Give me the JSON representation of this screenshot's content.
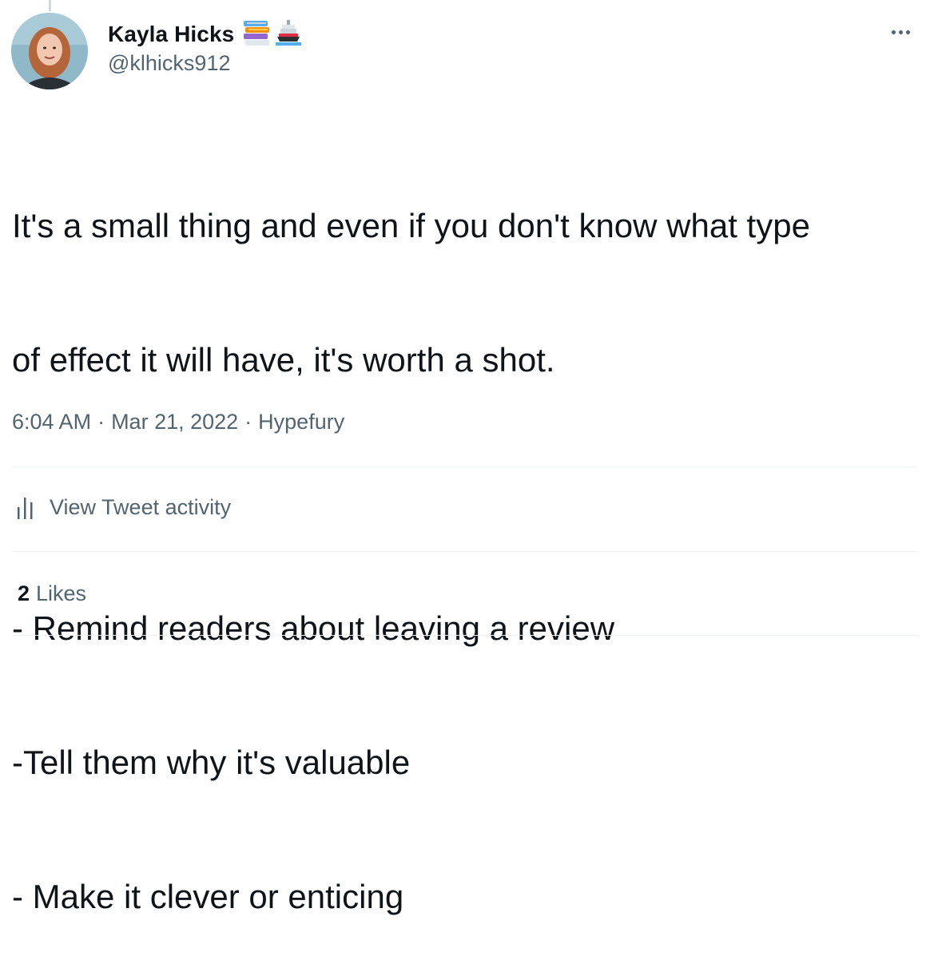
{
  "tweet": {
    "author": {
      "display_name": "Kayla Hicks",
      "handle": "@klhicks912",
      "name_emojis": [
        "books-emoji",
        "ship-emoji"
      ]
    },
    "text_lines": [
      "It's a small thing and even if you don't know what type",
      "of effect it will have, it's worth a shot.",
      "",
      "- Remind readers about leaving a review",
      "-Tell them why it's valuable",
      "- Make it clever or enticing"
    ],
    "time": "6:04 AM",
    "date": "Mar 21, 2022",
    "source": "Hypefury",
    "separator": "·",
    "activity_label": "View Tweet activity",
    "likes_count": "2",
    "likes_label": "Likes"
  },
  "icons": {
    "more": "more-icon",
    "activity": "bar-chart-icon"
  },
  "colors": {
    "text_primary": "#0f1419",
    "text_secondary": "#536471",
    "divider": "#eff3f4"
  }
}
